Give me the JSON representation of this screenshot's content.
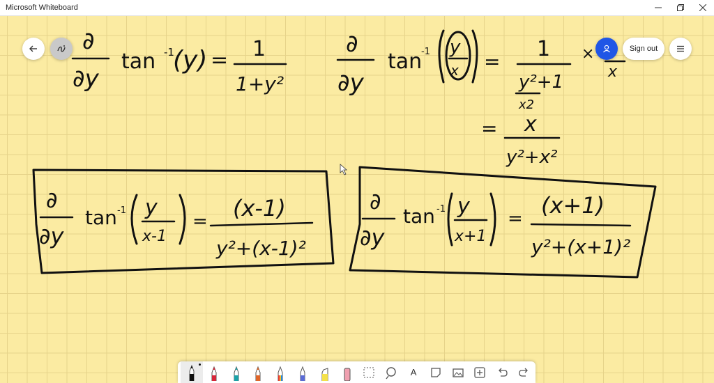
{
  "window": {
    "title": "Microsoft Whiteboard"
  },
  "header": {
    "sign_out_label": "Sign out"
  },
  "icons": {
    "back": "arrow-left-icon",
    "ink": "ink-beautify-icon",
    "avatar": "person-icon",
    "menu": "hamburger-menu-icon"
  },
  "colors": {
    "accent": "#1f56e6",
    "board": "#fbeba2",
    "ink": "#111111"
  },
  "board": {
    "eq1": {
      "d": "∂",
      "dy": "∂y",
      "fn": "tan",
      "inv": "-1",
      "arg": "(y)",
      "eq": "=",
      "num": "1",
      "den": "1+y²"
    },
    "eq2": {
      "d": "∂",
      "dy": "∂y",
      "fn": "tan",
      "inv": "-1",
      "num_arg": "y",
      "den_arg": "x",
      "eq": "=",
      "num": "1",
      "den": "y²+1",
      "den_sub": "x2",
      "times": "×",
      "x": "x"
    },
    "eq2b": {
      "eq": "=",
      "num": "x",
      "den": "y²+x²"
    },
    "box1": {
      "d": "∂",
      "dy": "∂y",
      "fn": "tan",
      "inv": "-1",
      "arg_num": "y",
      "arg_den": "x-1",
      "eq": "=",
      "num": "(x-1)",
      "den": "y²+(x-1)²"
    },
    "box2": {
      "d": "∂",
      "dy": "∂y",
      "fn": "tan",
      "inv": "-1",
      "arg_num": "y",
      "arg_den": "x+1",
      "eq": "=",
      "num": "(x+1)",
      "den": "y²+(x+1)²"
    }
  },
  "toolbar": {
    "tools": [
      "black-pen-icon",
      "red-pen-icon",
      "teal-pen-icon",
      "orange-pen-icon",
      "rainbow-pen-icon",
      "galaxy-pen-icon",
      "highlighter-icon",
      "eraser-icon",
      "lasso-select-icon",
      "ruler-icon",
      "text-icon",
      "note-icon",
      "image-icon",
      "add-icon",
      "undo-icon",
      "redo-icon"
    ],
    "text_glyph": "A"
  }
}
